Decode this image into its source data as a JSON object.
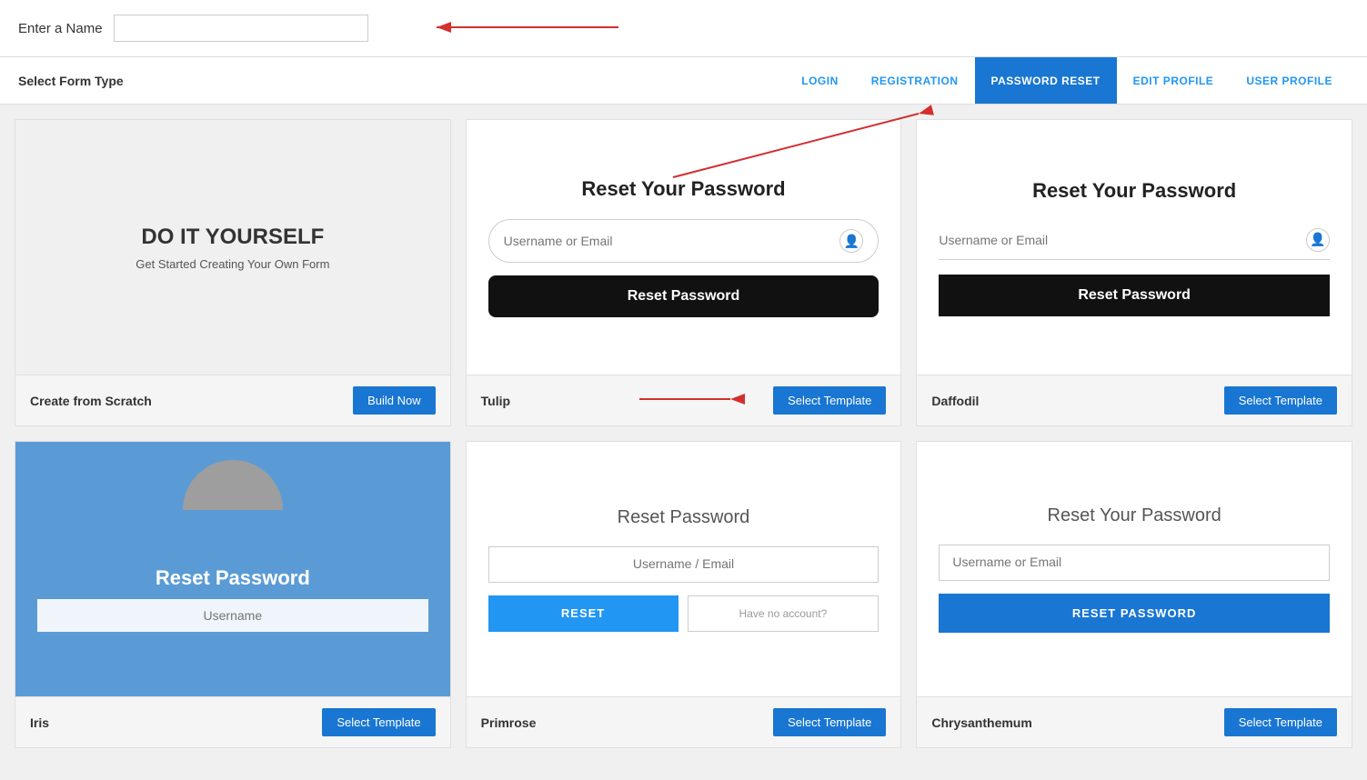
{
  "header": {
    "enter_name_label": "Enter a Name",
    "name_input_placeholder": ""
  },
  "form_type": {
    "label": "Select Form Type",
    "tabs": [
      {
        "id": "login",
        "label": "LOGIN",
        "active": false
      },
      {
        "id": "registration",
        "label": "REGISTRATION",
        "active": false
      },
      {
        "id": "password_reset",
        "label": "PASSWORD RESET",
        "active": true
      },
      {
        "id": "edit_profile",
        "label": "EDIT PROFILE",
        "active": false
      },
      {
        "id": "user_profile",
        "label": "USER PROFILE",
        "active": false
      }
    ]
  },
  "cards": {
    "row1": [
      {
        "id": "diy",
        "title": "DO IT YOURSELF",
        "subtitle": "Get Started Creating Your Own Form",
        "footer_name": "Create from Scratch",
        "footer_btn": "Build Now"
      },
      {
        "id": "tulip",
        "title": "Reset Your Password",
        "input_placeholder": "Username or Email",
        "btn_label": "Reset Password",
        "footer_name": "Tulip",
        "footer_btn": "Select Template"
      },
      {
        "id": "daffodil",
        "title": "Reset Your Password",
        "input_placeholder": "Username or Email",
        "btn_label": "Reset Password",
        "footer_name": "Daffodil",
        "footer_btn": "Select Template"
      }
    ],
    "row2": [
      {
        "id": "avatar",
        "title": "Reset Password",
        "input_placeholder": "Username",
        "footer_name": "Iris",
        "footer_btn": "Select Template"
      },
      {
        "id": "middle_bottom",
        "title": "Reset Password",
        "input_placeholder": "Username / Email",
        "btn_reset": "RESET",
        "btn_noaccount": "Have no account?",
        "footer_name": "Primrose",
        "footer_btn": "Select Template"
      },
      {
        "id": "right_bottom",
        "title": "Reset Your Password",
        "input_placeholder": "Username or Email",
        "btn_label": "RESET PASSWORD",
        "footer_name": "Chrysanthemum",
        "footer_btn": "Select Template"
      }
    ]
  }
}
